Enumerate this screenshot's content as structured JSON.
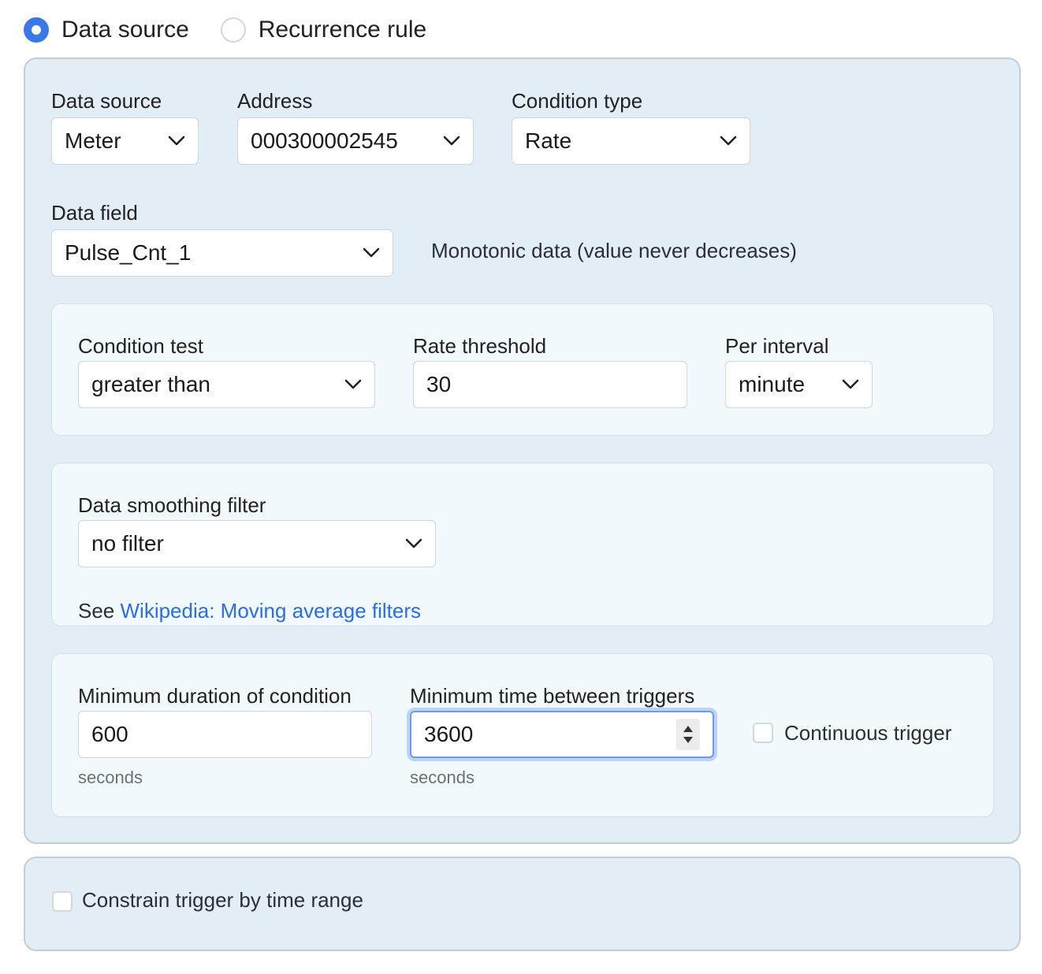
{
  "mode": {
    "options": [
      {
        "label": "Data source",
        "checked": true
      },
      {
        "label": "Recurrence rule",
        "checked": false
      }
    ]
  },
  "source": {
    "data_source": {
      "label": "Data source",
      "value": "Meter"
    },
    "address": {
      "label": "Address",
      "value": "000300002545"
    },
    "condition_type": {
      "label": "Condition type",
      "value": "Rate"
    },
    "data_field": {
      "label": "Data field",
      "value": "Pulse_Cnt_1"
    },
    "data_field_note": "Monotonic data (value never decreases)"
  },
  "condition": {
    "test": {
      "label": "Condition test",
      "value": "greater than"
    },
    "rate_threshold": {
      "label": "Rate threshold",
      "value": "30"
    },
    "per_interval": {
      "label": "Per interval",
      "value": "minute"
    }
  },
  "smoothing": {
    "label": "Data smoothing filter",
    "value": "no filter",
    "see_prefix": "See ",
    "link_text": "Wikipedia: Moving average filters"
  },
  "timing": {
    "min_duration": {
      "label": "Minimum duration of condition",
      "value": "600",
      "unit": "seconds"
    },
    "min_between": {
      "label": "Minimum time between triggers",
      "value": "3600",
      "unit": "seconds"
    },
    "continuous_trigger": {
      "label": "Continuous trigger",
      "checked": false
    }
  },
  "constraint": {
    "label": "Constrain trigger by time range",
    "checked": false
  },
  "colors": {
    "accent": "#3b78e7",
    "panel_bg": "#e3edf6",
    "subpanel_bg": "#f1f9fc",
    "link": "#2a6ee6"
  }
}
